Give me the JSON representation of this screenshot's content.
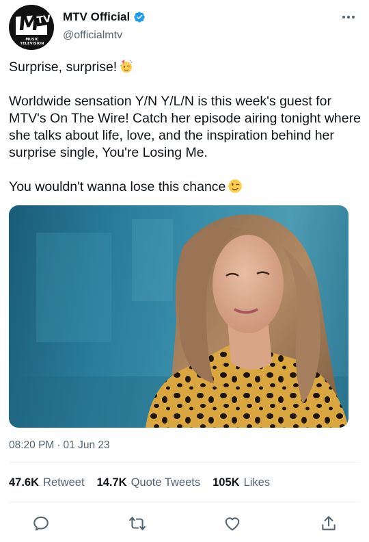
{
  "author": {
    "display_name": "MTV Official",
    "handle": "@officialmtv",
    "verified_icon": "verified-badge-icon",
    "avatar": {
      "logo_letter": "M",
      "logo_tv": "TV",
      "logo_subtitle": "MUSIC TELEVISION"
    }
  },
  "tweet": {
    "paragraphs": [
      "Surprise, surprise!",
      "Worldwide sensation Y/N Y/L/N is this week's guest for MTV's On The Wire! Catch her episode airing tonight where she talks about life, love, and the inspiration behind her surprise single, You're Losing Me.",
      "You wouldn't wanna lose this chance"
    ],
    "emojis": [
      "partying-face-emoji",
      "winking-face-emoji"
    ],
    "media_description": "photo-woman-leopard-print-blouse"
  },
  "meta": {
    "time": "08:20 PM",
    "separator": "·",
    "date": "01 Jun 23"
  },
  "stats": {
    "retweets": {
      "count": "47.6K",
      "label": "Retweet"
    },
    "quotes": {
      "count": "14.7K",
      "label": "Quote Tweets"
    },
    "likes": {
      "count": "105K",
      "label": "Likes"
    }
  },
  "actions": [
    "reply-icon",
    "retweet-icon",
    "like-icon",
    "share-icon"
  ],
  "colors": {
    "text": "#0f1419",
    "secondary": "#536471",
    "verified": "#1d9bf0",
    "divider": "#eff3f4"
  }
}
